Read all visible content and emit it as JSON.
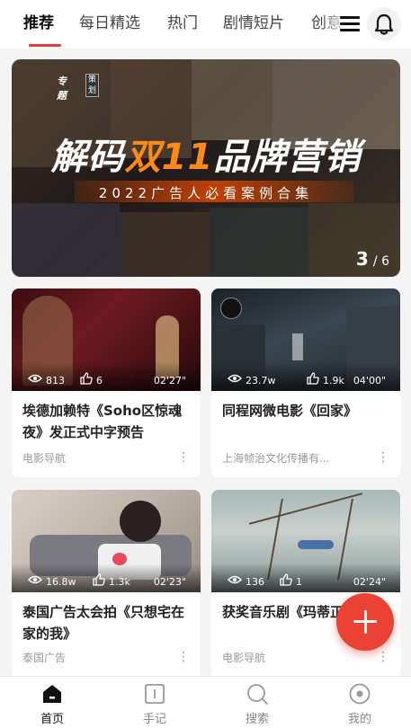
{
  "tabs": {
    "items": [
      "推荐",
      "每日精选",
      "热门",
      "剧情短片",
      "创意"
    ],
    "active_index": 0
  },
  "banner": {
    "badge_primary": "专题",
    "badge_secondary": "策划",
    "title_part1": "解码",
    "title_highlight": "双11",
    "title_part2": "品牌营销",
    "subtitle": "2022广告人必看案例合集",
    "page_current": "3",
    "page_total": "/ 6"
  },
  "cards": [
    {
      "views": "813",
      "likes": "6",
      "duration": "02'27\"",
      "title": "埃德加赖特《Soho区惊魂夜》发正式中字预告",
      "source": "电影导航"
    },
    {
      "views": "23.7w",
      "likes": "1.9k",
      "duration": "04'00\"",
      "title": "同程网微电影《回家》",
      "source": "上海帧治文化传播有..."
    },
    {
      "views": "16.8w",
      "likes": "1.3k",
      "duration": "02'23\"",
      "title": "泰国广告太会拍《只想宅在家的我》",
      "source": "泰国广告"
    },
    {
      "views": "136",
      "likes": "1",
      "duration": "02'24\"",
      "title": "获奖音乐剧《玛蒂正式预告",
      "source": "电影导航"
    }
  ],
  "bottom_nav": {
    "items": [
      "首页",
      "手记",
      "搜索",
      "我的"
    ],
    "active_index": 0
  },
  "colors": {
    "accent": "#e23b3b",
    "fab": "#ea4335",
    "banner_highlight": "#ff8a1a"
  }
}
